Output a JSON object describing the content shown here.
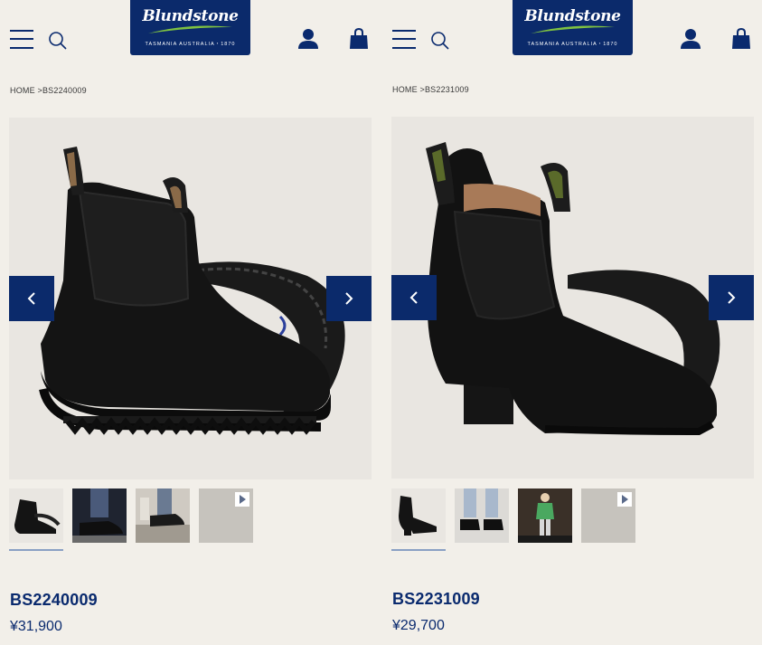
{
  "brand": {
    "name": "Blundstone",
    "tagline": "TASMANIA AUSTRALIA・1870",
    "colors": {
      "primary": "#0b2a6b",
      "accent": "#7fc241",
      "background": "#f2efe9"
    }
  },
  "header": {
    "icons": [
      "hamburger-menu-icon",
      "search-icon",
      "account-icon",
      "cart-icon"
    ]
  },
  "products": [
    {
      "breadcrumb": {
        "home": "HOME",
        "separator": " >",
        "current": "BS2240009"
      },
      "name": "BS2240009",
      "price": "¥31,900",
      "thumbnails": [
        "boot-side",
        "boot-worn-jeans",
        "boot-on-stone",
        "video"
      ],
      "selected_thumbnail": 0
    },
    {
      "breadcrumb": {
        "home": "HOME",
        "separator": " >",
        "current": "BS2231009"
      },
      "name": "BS2231009",
      "price": "¥29,700",
      "thumbnails": [
        "heel-boot-side",
        "boot-worn-jeans",
        "model-green-jacket",
        "video"
      ],
      "selected_thumbnail": 0
    }
  ]
}
